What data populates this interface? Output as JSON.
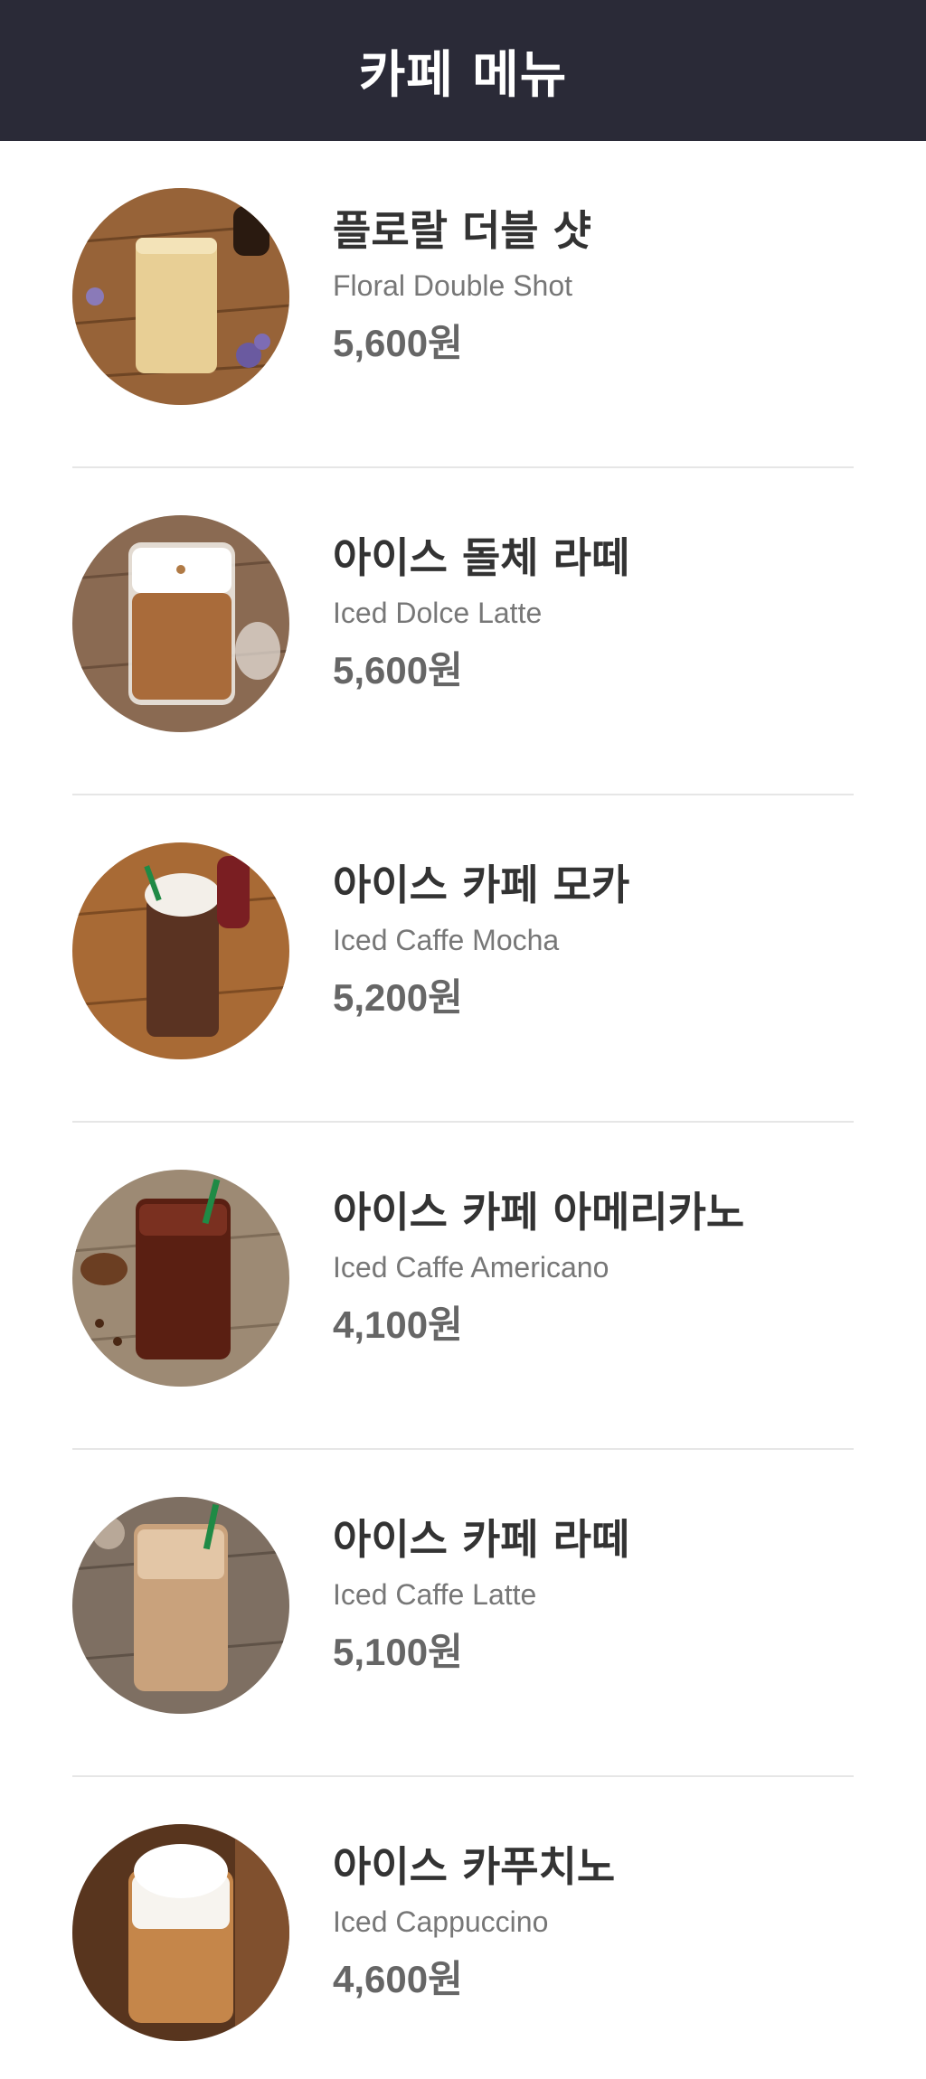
{
  "header": {
    "title": "카페 메뉴"
  },
  "colors": {
    "header_bg": "#2a2a37",
    "divider": "#e6e6e6",
    "name_text": "#333333",
    "sub_text": "#777777",
    "price_text": "#666666"
  },
  "menu": [
    {
      "name_ko": "플로랄 더블 샷",
      "name_en": "Floral Double Shot",
      "price": "5,600원",
      "drink": "floral-double-shot-icon"
    },
    {
      "name_ko": "아이스 돌체 라떼",
      "name_en": "Iced Dolce Latte",
      "price": "5,600원",
      "drink": "iced-dolce-latte-icon"
    },
    {
      "name_ko": "아이스 카페 모카",
      "name_en": "Iced Caffe Mocha",
      "price": "5,200원",
      "drink": "iced-caffe-mocha-icon"
    },
    {
      "name_ko": "아이스 카페 아메리카노",
      "name_en": "Iced Caffe Americano",
      "price": "4,100원",
      "drink": "iced-caffe-americano-icon"
    },
    {
      "name_ko": "아이스 카페 라떼",
      "name_en": "Iced Caffe Latte",
      "price": "5,100원",
      "drink": "iced-caffe-latte-icon"
    },
    {
      "name_ko": "아이스 카푸치노",
      "name_en": "Iced Cappuccino",
      "price": "4,600원",
      "drink": "iced-cappuccino-icon"
    }
  ]
}
